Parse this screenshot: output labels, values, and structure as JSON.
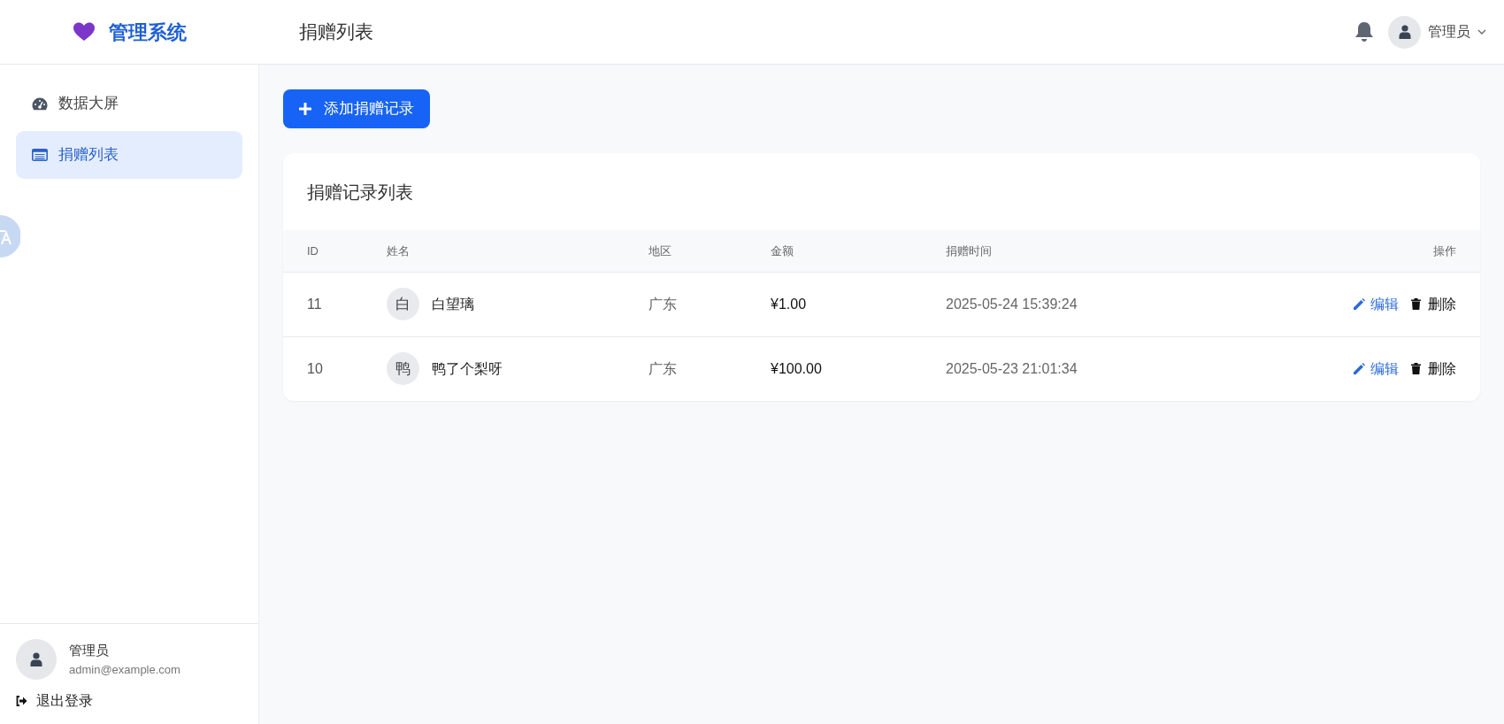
{
  "header": {
    "logo": "管理系统",
    "page_title": "捐赠列表",
    "user": "管理员"
  },
  "sidebar": {
    "items": [
      {
        "label": "数据大屏",
        "kind": "dashboard",
        "selected": false
      },
      {
        "label": "捐赠列表",
        "kind": "list",
        "selected": true
      }
    ],
    "user": {
      "name": "管理员",
      "email": "admin@example.com"
    },
    "logout": "退出登录"
  },
  "add_button": "添加捐赠记录",
  "table": {
    "title": "捐赠记录列表",
    "columns": [
      "ID",
      "姓名",
      "地区",
      "金额",
      "捐赠时间",
      "操作"
    ],
    "rows": [
      {
        "id": "11",
        "avatar": "白",
        "name": "白望璃",
        "region": "广东",
        "amount": "¥1.00",
        "time": "2025-05-24 15:39:24",
        "edit": "编辑",
        "delete": "删除"
      },
      {
        "id": "10",
        "avatar": "鸭",
        "name": "鸭了个梨呀",
        "region": "广东",
        "amount": "¥100.00",
        "time": "2025-05-23 21:01:34",
        "edit": "编辑",
        "delete": "删除"
      }
    ]
  }
}
